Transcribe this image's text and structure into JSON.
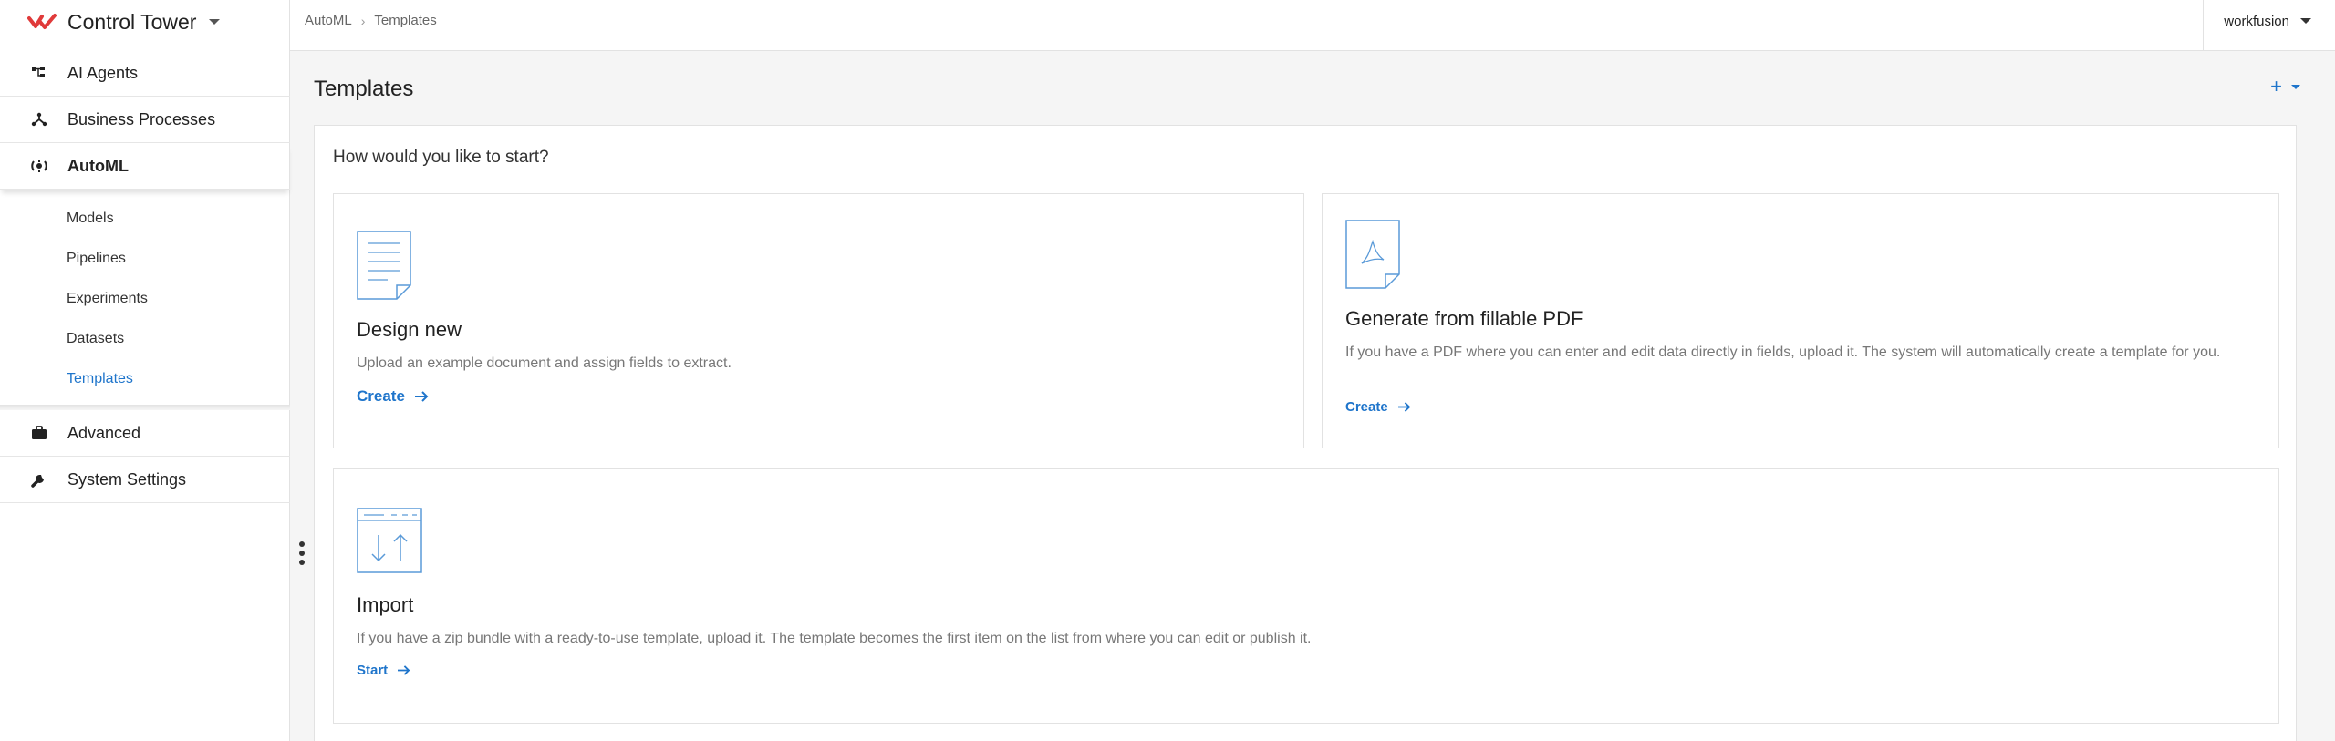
{
  "app": {
    "name": "Control Tower"
  },
  "colors": {
    "accent": "#1f75cb",
    "brand_red": "#e03a3a"
  },
  "sidebar": {
    "items": [
      {
        "label": "AI Agents",
        "icon": "hierarchy-icon"
      },
      {
        "label": "Business Processes",
        "icon": "process-branch-icon"
      },
      {
        "label": "AutoML",
        "icon": "automl-gear-icon"
      },
      {
        "label": "Advanced",
        "icon": "briefcase-icon"
      },
      {
        "label": "System Settings",
        "icon": "wrench-icon"
      }
    ],
    "sub_items": [
      "Models",
      "Pipelines",
      "Experiments",
      "Datasets",
      "Templates"
    ]
  },
  "breadcrumb": {
    "parent": "AutoML",
    "current": "Templates"
  },
  "user": {
    "name": "workfusion"
  },
  "page": {
    "title": "Templates",
    "add_label": "+",
    "question": "How would you like to start?"
  },
  "cards": [
    {
      "title": "Design new",
      "description": "Upload an example document and assign fields to extract.",
      "link": "Create",
      "icon": "document-icon"
    },
    {
      "title": "Generate from fillable PDF",
      "description": "If you have a PDF where you can enter and edit data directly in fields, upload it. The system will automatically create a template for you.",
      "link": "Create",
      "icon": "pdf-icon"
    },
    {
      "title": "Import",
      "description": "If you have a zip bundle with a ready-to-use template, upload it. The template becomes the first item on the list from where you can edit or publish it.",
      "link": "Start",
      "icon": "import-icon"
    }
  ]
}
